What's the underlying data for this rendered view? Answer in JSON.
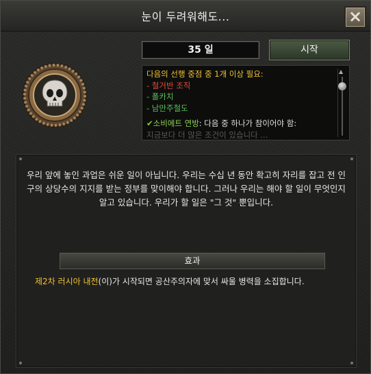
{
  "window": {
    "title": "눈이 두려워해도...",
    "close_icon": "×"
  },
  "decision": {
    "icon": "skull-medal-icon",
    "days": "35 일",
    "start_label": "시작"
  },
  "prerequisites": {
    "header": "다음의 선행 중점 중 1개 이상 필요:",
    "items": [
      "- 철거반 조직",
      "- 폴카치",
      "- 남만주철도"
    ],
    "condition_check": "✔",
    "condition_name": "소비에트 연방",
    "condition_rest": ": 다음 중 하나가 참이어야 함:",
    "cutoff_line": "지금보다 더 많은 조건이 있습니다 ..."
  },
  "description": "우리 앞에 놓인 과업은 쉬운 일이 아닙니다. 우리는 수십 년 동안 확고히 자리를 잡고 전 인구의 상당수의 지지를 받는 정부를 맞이해야 합니다. 그러나 우리는 해야 할 일이 무엇인지 알고 있습니다. 우리가 할 일은 \"그 것\" 뿐입니다.",
  "effects": {
    "header": "효과",
    "highlight": "제2차 러시아 내전",
    "text": "(이)가 시작되면 공산주의자에 맞서 싸울 병력을 소집합니다."
  },
  "colors": {
    "accent_yellow": "#f1c232",
    "red": "#e74c3c",
    "green": "#5cc05c"
  }
}
